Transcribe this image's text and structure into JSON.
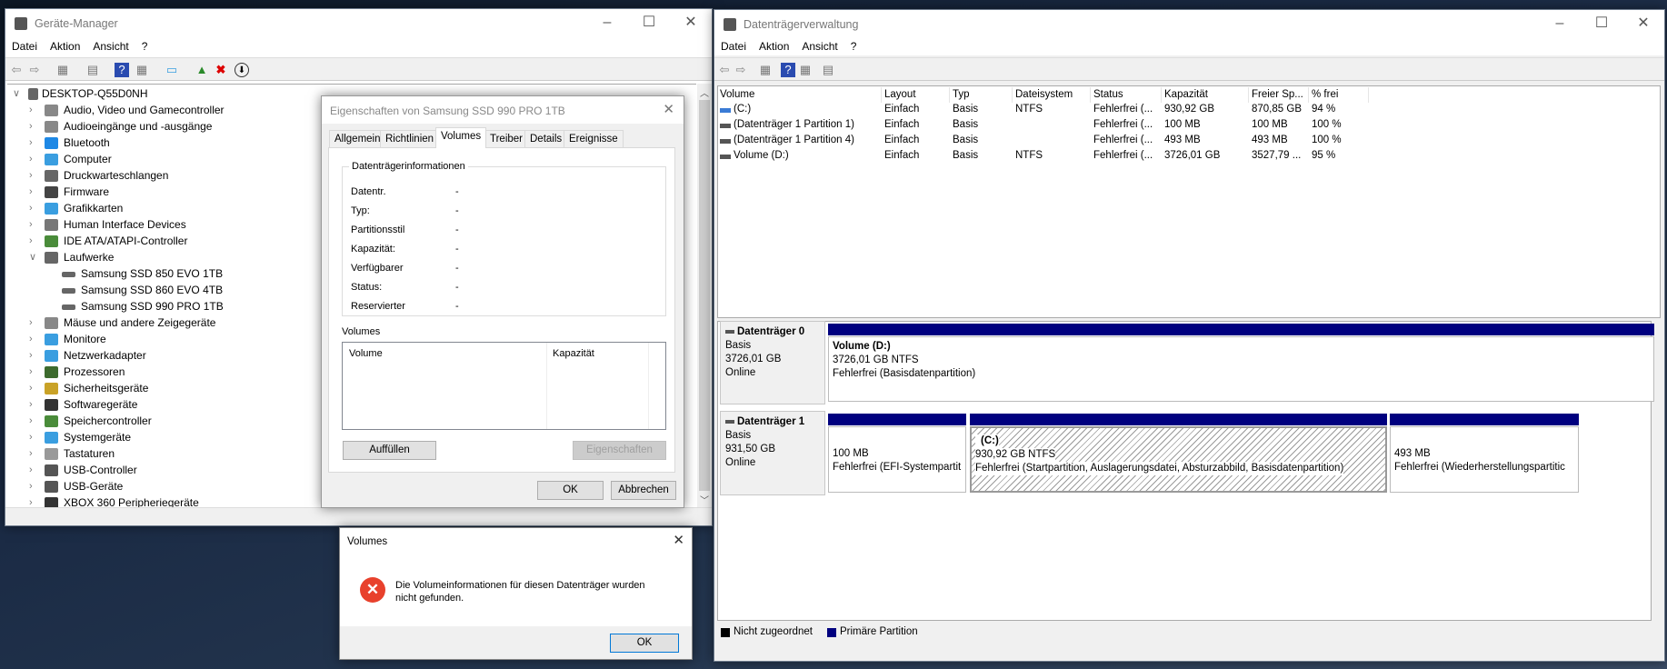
{
  "device_manager": {
    "title": "Geräte-Manager",
    "menu": [
      "Datei",
      "Aktion",
      "Ansicht",
      "?"
    ],
    "root": "DESKTOP-Q55D0NH",
    "tree": [
      {
        "label": "Audio, Video und Gamecontroller",
        "icon": "speaker-icon",
        "color": "#888",
        "expanded": false
      },
      {
        "label": "Audioeingänge und -ausgänge",
        "icon": "speaker-icon",
        "color": "#888",
        "expanded": false
      },
      {
        "label": "Bluetooth",
        "icon": "bluetooth-icon",
        "color": "#1e88e5",
        "expanded": false
      },
      {
        "label": "Computer",
        "icon": "computer-icon",
        "color": "#3a9ee0",
        "expanded": false
      },
      {
        "label": "Druckwarteschlangen",
        "icon": "printer-icon",
        "color": "#666",
        "expanded": false
      },
      {
        "label": "Firmware",
        "icon": "firmware-icon",
        "color": "#444",
        "expanded": false
      },
      {
        "label": "Grafikkarten",
        "icon": "display-adapter-icon",
        "color": "#3a9ee0",
        "expanded": false
      },
      {
        "label": "Human Interface Devices",
        "icon": "hid-icon",
        "color": "#777",
        "expanded": false
      },
      {
        "label": "IDE ATA/ATAPI-Controller",
        "icon": "ide-controller-icon",
        "color": "#4a8c3a",
        "expanded": false
      },
      {
        "label": "Laufwerke",
        "icon": "drive-icon",
        "color": "#666",
        "expanded": true,
        "children": [
          "Samsung SSD 850 EVO 1TB",
          "Samsung SSD 860 EVO 4TB",
          "Samsung SSD 990 PRO 1TB"
        ]
      },
      {
        "label": "Mäuse und andere Zeigegeräte",
        "icon": "mouse-icon",
        "color": "#888",
        "expanded": false
      },
      {
        "label": "Monitore",
        "icon": "monitor-icon",
        "color": "#3a9ee0",
        "expanded": false
      },
      {
        "label": "Netzwerkadapter",
        "icon": "network-icon",
        "color": "#3a9ee0",
        "expanded": false
      },
      {
        "label": "Prozessoren",
        "icon": "processor-icon",
        "color": "#3d6b2e",
        "expanded": false
      },
      {
        "label": "Sicherheitsgeräte",
        "icon": "security-key-icon",
        "color": "#c9a227",
        "expanded": false
      },
      {
        "label": "Softwaregeräte",
        "icon": "software-device-icon",
        "color": "#333",
        "expanded": false
      },
      {
        "label": "Speichercontroller",
        "icon": "storage-controller-icon",
        "color": "#4a8c3a",
        "expanded": false
      },
      {
        "label": "Systemgeräte",
        "icon": "system-devices-icon",
        "color": "#3a9ee0",
        "expanded": false
      },
      {
        "label": "Tastaturen",
        "icon": "keyboard-icon",
        "color": "#999",
        "expanded": false
      },
      {
        "label": "USB-Controller",
        "icon": "usb-icon",
        "color": "#555",
        "expanded": false
      },
      {
        "label": "USB-Geräte",
        "icon": "usb-icon",
        "color": "#555",
        "expanded": false
      },
      {
        "label": "XBOX 360 Peripheriegeräte",
        "icon": "gamepad-icon",
        "color": "#333",
        "expanded": false
      }
    ]
  },
  "properties_dialog": {
    "title": "Eigenschaften von Samsung SSD 990 PRO 1TB",
    "tabs": [
      "Allgemein",
      "Richtlinien",
      "Volumes",
      "Treiber",
      "Details",
      "Ereignisse"
    ],
    "active_tab": "Volumes",
    "group_title": "Datenträgerinformationen",
    "fields": [
      {
        "label": "Datentr.",
        "value": "-"
      },
      {
        "label": "Typ:",
        "value": "-"
      },
      {
        "label": "Partitionsstil",
        "value": "-"
      },
      {
        "label": "Kapazität:",
        "value": "-"
      },
      {
        "label": "Verfügbarer",
        "value": "-"
      },
      {
        "label": "Status:",
        "value": "-"
      },
      {
        "label": "Reservierter",
        "value": "-"
      }
    ],
    "volumes_label": "Volumes",
    "volumes_columns": [
      "Volume",
      "Kapazität"
    ],
    "populate_button": "Auffüllen",
    "properties_button": "Eigenschaften",
    "ok": "OK",
    "cancel": "Abbrechen"
  },
  "message_box": {
    "title": "Volumes",
    "icon": "error-icon",
    "text_line1": "Die Volumeinformationen für diesen Datenträger wurden",
    "text_line2": "nicht gefunden.",
    "ok": "OK"
  },
  "disk_management": {
    "title": "Datenträgerverwaltung",
    "menu": [
      "Datei",
      "Aktion",
      "Ansicht",
      "?"
    ],
    "columns": [
      "Volume",
      "Layout",
      "Typ",
      "Dateisystem",
      "Status",
      "Kapazität",
      "Freier Sp...",
      "% frei"
    ],
    "rows": [
      [
        "(C:)",
        "Einfach",
        "Basis",
        "NTFS",
        "Fehlerfrei (...",
        "930,92 GB",
        "870,85 GB",
        "94 %"
      ],
      [
        "(Datenträger 1 Partition 1)",
        "Einfach",
        "Basis",
        "",
        "Fehlerfrei (...",
        "100 MB",
        "100 MB",
        "100 %"
      ],
      [
        "(Datenträger 1 Partition 4)",
        "Einfach",
        "Basis",
        "",
        "Fehlerfrei (...",
        "493 MB",
        "493 MB",
        "100 %"
      ],
      [
        "Volume (D:)",
        "Einfach",
        "Basis",
        "NTFS",
        "Fehlerfrei (...",
        "3726,01 GB",
        "3527,79 ...",
        "95 %"
      ]
    ],
    "disks": [
      {
        "name": "Datenträger 0",
        "type": "Basis",
        "size": "3726,01 GB",
        "state": "Online",
        "partitions": [
          {
            "title": "Volume  (D:)",
            "size": "3726,01 GB NTFS",
            "status": "Fehlerfrei (Basisdatenpartition)"
          }
        ]
      },
      {
        "name": "Datenträger 1",
        "type": "Basis",
        "size": "931,50 GB",
        "state": "Online",
        "partitions": [
          {
            "title": "",
            "size": "100 MB",
            "status": "Fehlerfrei (EFI-Systempartit"
          },
          {
            "title": "(C:)",
            "size": "930,92 GB NTFS",
            "status": "Fehlerfrei (Startpartition, Auslagerungsdatei, Absturzabbild, Basisdatenpartition)"
          },
          {
            "title": "",
            "size": "493 MB",
            "status": "Fehlerfrei (Wiederherstellungspartitic"
          }
        ]
      }
    ],
    "legend": [
      {
        "label": "Nicht zugeordnet",
        "color": "#000000"
      },
      {
        "label": "Primäre Partition",
        "color": "#00007f"
      }
    ]
  }
}
